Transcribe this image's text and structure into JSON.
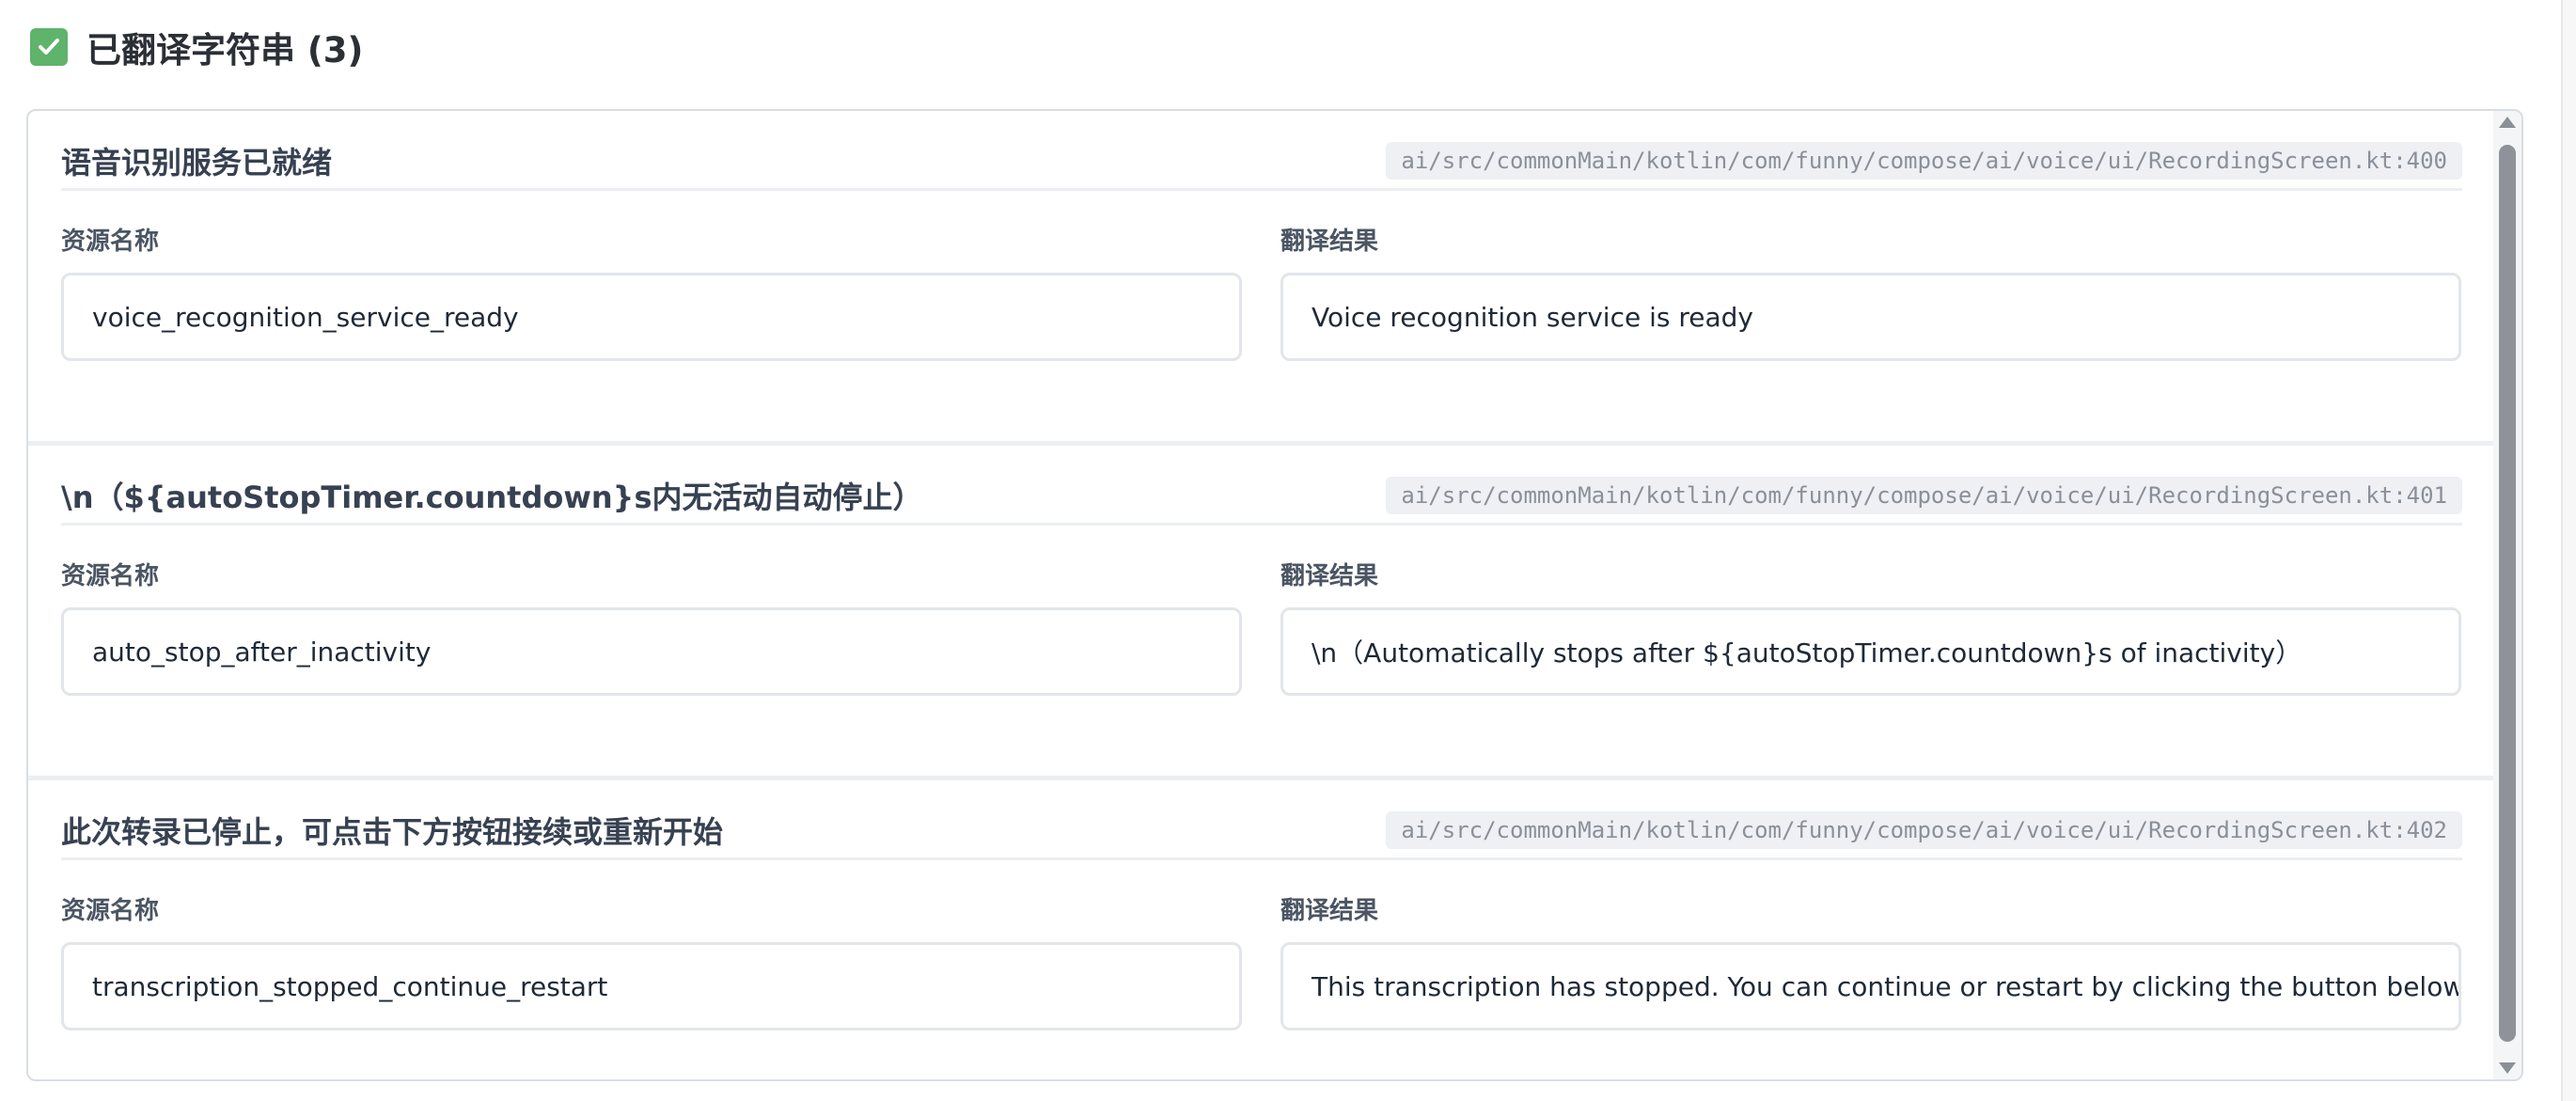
{
  "header": {
    "icon": "check-icon",
    "title": "已翻译字符串 (3)",
    "icon_color": "#5fb36a"
  },
  "items": [
    {
      "source": "语音识别服务已就绪",
      "path": "ai/src/commonMain/kotlin/com/funny/compose/ai/voice/ui/RecordingScreen.kt:400",
      "name_label": "资源名称",
      "name_value": "voice_recognition_service_ready",
      "result_label": "翻译结果",
      "result_value": "Voice recognition service is ready"
    },
    {
      "source": "\\n（${autoStopTimer.countdown}s内无活动自动停止）",
      "path": "ai/src/commonMain/kotlin/com/funny/compose/ai/voice/ui/RecordingScreen.kt:401",
      "name_label": "资源名称",
      "name_value": "auto_stop_after_inactivity",
      "result_label": "翻译结果",
      "result_value": "\\n（Automatically stops after ${autoStopTimer.countdown}s of inactivity）"
    },
    {
      "source": "此次转录已停止，可点击下方按钮接续或重新开始",
      "path": "ai/src/commonMain/kotlin/com/funny/compose/ai/voice/ui/RecordingScreen.kt:402",
      "name_label": "资源名称",
      "name_value": "transcription_stopped_continue_restart",
      "result_label": "翻译结果",
      "result_value": "This transcription has stopped. You can continue or restart by clicking the button below."
    }
  ]
}
